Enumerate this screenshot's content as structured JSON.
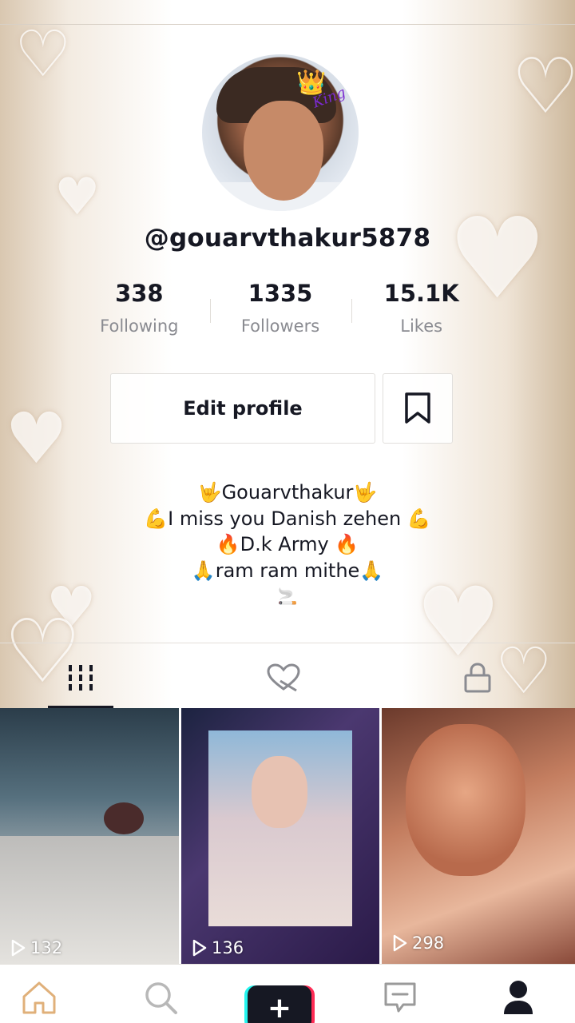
{
  "profile": {
    "username": "@gouarvthakur5878",
    "avatar_crown_text": "King"
  },
  "stats": [
    {
      "value": "338",
      "label": "Following"
    },
    {
      "value": "1335",
      "label": "Followers"
    },
    {
      "value": "15.1K",
      "label": "Likes"
    }
  ],
  "actions": {
    "edit_profile_label": "Edit profile",
    "bookmark_icon": "bookmark-icon"
  },
  "bio": {
    "lines": [
      "🤟Gouarvthakur🤟",
      "💪I miss you Danish zehen 💪",
      "🔥D.k Army 🔥",
      "🙏ram ram mithe🙏",
      "🚬"
    ]
  },
  "tabs": [
    {
      "icon": "grid-icon",
      "active": true
    },
    {
      "icon": "liked-hidden-icon",
      "active": false
    },
    {
      "icon": "lock-icon",
      "active": false
    }
  ],
  "videos": [
    {
      "views": "132"
    },
    {
      "views": "136"
    },
    {
      "views": "298"
    }
  ],
  "nav": {
    "items": [
      "home-icon",
      "search-icon",
      "create-icon",
      "inbox-icon",
      "profile-icon"
    ],
    "create_symbol": "+"
  },
  "colors": {
    "text": "#161823",
    "secondary_text": "#8a8b91",
    "accent_cyan": "#25f4ee",
    "accent_red": "#fe2c55"
  }
}
